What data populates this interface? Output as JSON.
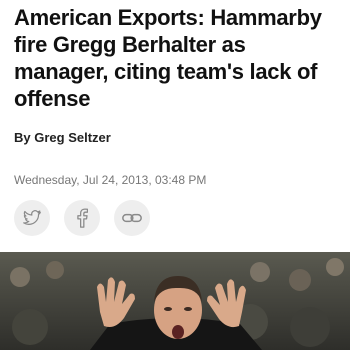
{
  "article": {
    "headline": "American Exports: Hammarby fire Gregg Berhalter as manager, citing team's lack of offense",
    "byline_prefix": "By",
    "author": "Greg Seltzer",
    "timestamp": "Wednesday, Jul 24, 2013, 03:48 PM"
  },
  "share": {
    "buttons": [
      {
        "icon": "twitter-icon"
      },
      {
        "icon": "facebook-icon"
      },
      {
        "icon": "link-icon"
      }
    ],
    "icon_color": "#8a8a8a",
    "button_bg": "#eeeeee"
  },
  "hero_image": {
    "subject": "photo"
  }
}
